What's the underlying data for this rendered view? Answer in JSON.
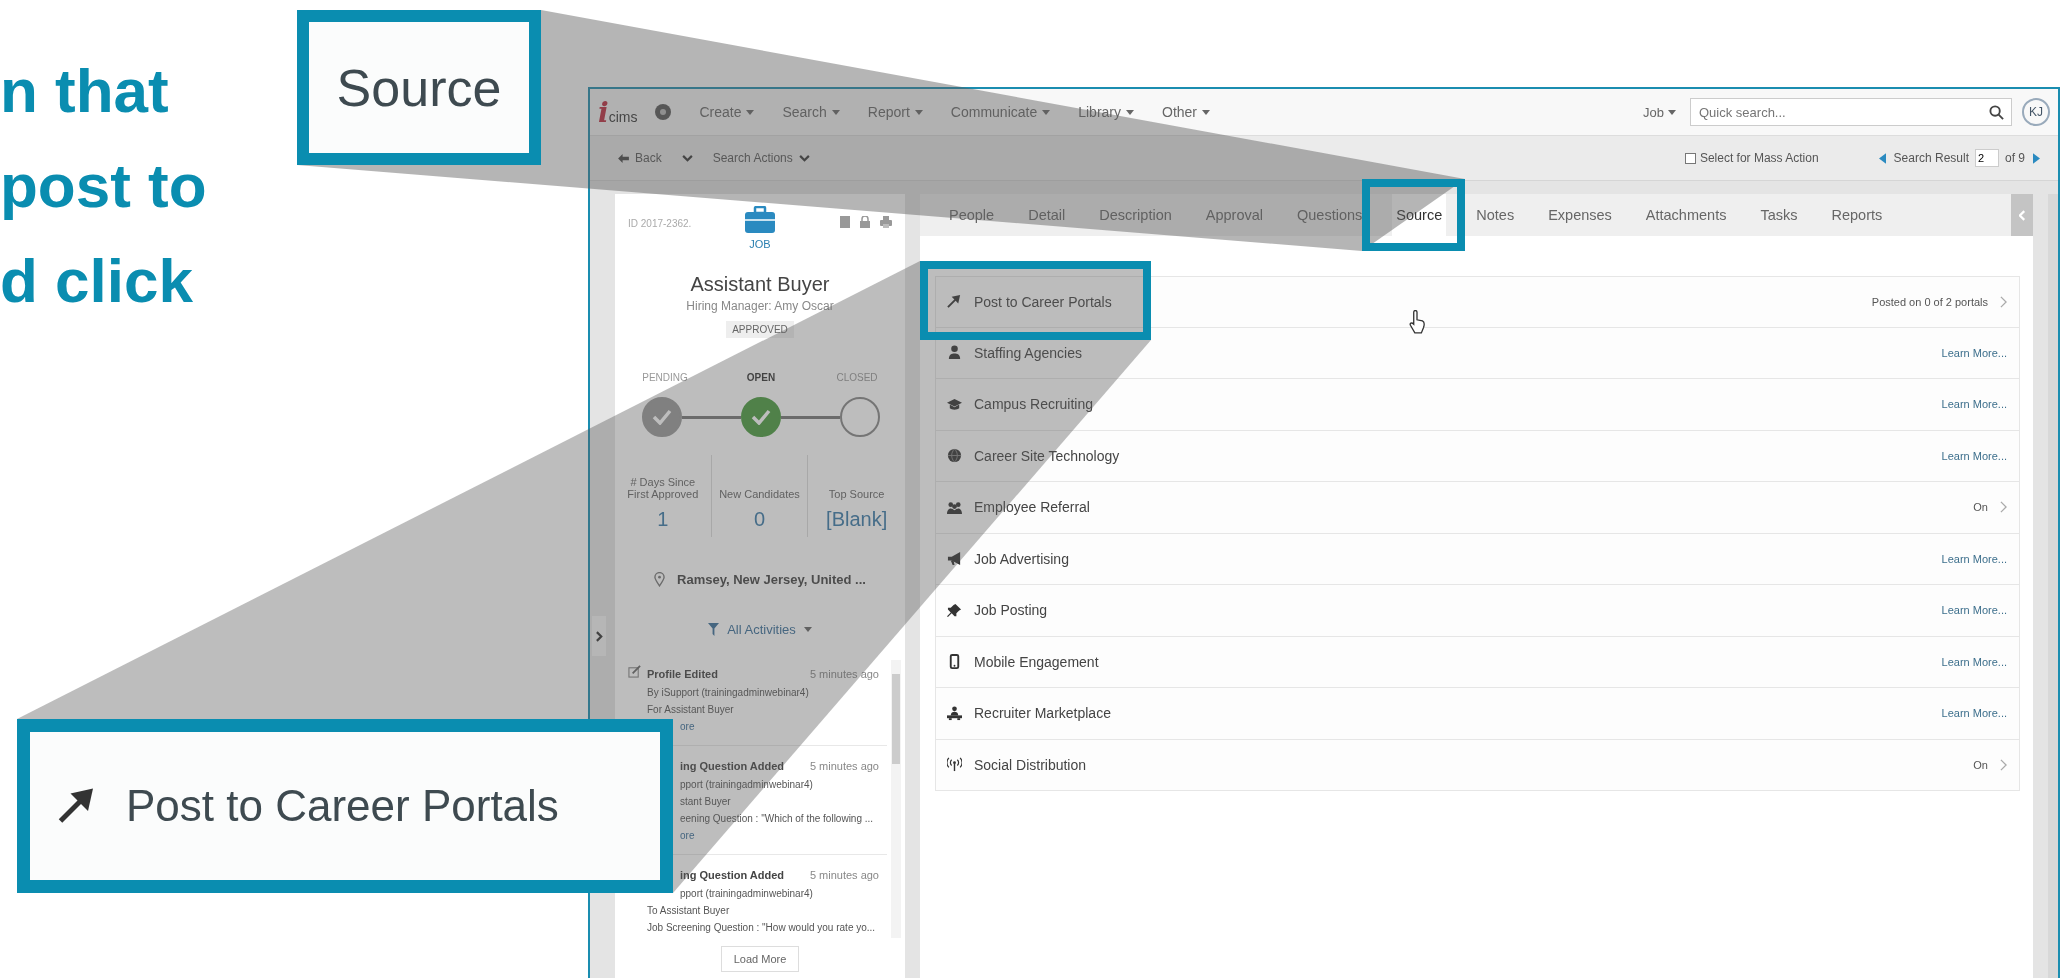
{
  "instruction_text": {
    "lines": [
      "n that",
      "post to",
      "d click"
    ]
  },
  "callouts": [
    {
      "kind": "tab",
      "label": "Source"
    },
    {
      "kind": "row",
      "label": "Post to Career Portals"
    }
  ],
  "app": {
    "logo": {
      "mark": "i",
      "text": "cims"
    },
    "menus": [
      "Create",
      "Search",
      "Report",
      "Communicate",
      "Library",
      "Other"
    ],
    "search": {
      "scope": "Job",
      "placeholder": "Quick search..."
    },
    "avatar": "KJ",
    "actions": {
      "back": "Back",
      "search_actions": "Search Actions",
      "mass_action": {
        "label": "Select for Mass Action",
        "checked": false
      },
      "result": {
        "label": "Search Result",
        "value": "2",
        "total": "of 9"
      }
    },
    "record": {
      "id": "ID 2017-2362.",
      "type": "JOB",
      "title": "Assistant Buyer",
      "manager": "Hiring Manager: Amy Oscar",
      "status": "APPROVED",
      "stages": [
        {
          "label": "PENDING",
          "done": true,
          "selected": false
        },
        {
          "label": "OPEN",
          "done": true,
          "selected": true
        },
        {
          "label": "CLOSED",
          "done": false,
          "selected": false
        }
      ],
      "stats": [
        {
          "label": "# Days Since First Approved",
          "value": "1"
        },
        {
          "label": "New Candidates",
          "value": "0"
        },
        {
          "label": "Top Source",
          "value": "[Blank]"
        }
      ],
      "location": "Ramsey, New Jersey, United ...",
      "filter": "All Activities",
      "activities": [
        {
          "title": "Profile Edited",
          "time": "5 minutes ago",
          "lines": [
            {
              "kind": "text",
              "text": "By iSupport (trainingadminwebinar4)"
            },
            {
              "kind": "text",
              "text": "For Assistant Buyer"
            },
            {
              "kind": "link",
              "text": "ore"
            }
          ]
        },
        {
          "title": "ing Question Added",
          "time": "5 minutes ago",
          "lines": [
            {
              "kind": "text",
              "text": "pport (trainingadminwebinar4)"
            },
            {
              "kind": "text",
              "text": "stant Buyer"
            },
            {
              "kind": "text",
              "text": "eening Question : \"Which of the following ..."
            },
            {
              "kind": "link",
              "text": "ore"
            }
          ]
        },
        {
          "title": "ing Question Added",
          "time": "5 minutes ago",
          "lines": [
            {
              "kind": "text",
              "text": "pport (trainingadminwebinar4)"
            },
            {
              "kind": "text",
              "text": "To Assistant Buyer"
            },
            {
              "kind": "text",
              "text": "Job Screening Question : \"How would you rate yo..."
            }
          ]
        }
      ],
      "load_more": "Load More"
    },
    "tabs": [
      {
        "label": "People",
        "selected": false
      },
      {
        "label": "Detail",
        "selected": false
      },
      {
        "label": "Description",
        "selected": false
      },
      {
        "label": "Approval",
        "selected": false
      },
      {
        "label": "Questions",
        "selected": false
      },
      {
        "label": "Source",
        "selected": true
      },
      {
        "label": "Notes",
        "selected": false
      },
      {
        "label": "Expenses",
        "selected": false
      },
      {
        "label": "Attachments",
        "selected": false
      },
      {
        "label": "Tasks",
        "selected": false
      },
      {
        "label": "Reports",
        "selected": false
      }
    ],
    "sources": [
      {
        "label": "Post to Career Portals",
        "kind": "status",
        "value": "Posted on 0 of 2 portals"
      },
      {
        "label": "Staffing Agencies",
        "kind": "link",
        "value": "Learn More..."
      },
      {
        "label": "Campus Recruiting",
        "kind": "link",
        "value": "Learn More..."
      },
      {
        "label": "Career Site Technology",
        "kind": "link",
        "value": "Learn More..."
      },
      {
        "label": "Employee Referral",
        "kind": "status",
        "value": "On"
      },
      {
        "label": "Job Advertising",
        "kind": "link",
        "value": "Learn More..."
      },
      {
        "label": "Job Posting",
        "kind": "link",
        "value": "Learn More..."
      },
      {
        "label": "Mobile Engagement",
        "kind": "link",
        "value": "Learn More..."
      },
      {
        "label": "Recruiter Marketplace",
        "kind": "link",
        "value": "Learn More..."
      },
      {
        "label": "Social Distribution",
        "kind": "status",
        "value": "On"
      }
    ]
  }
}
